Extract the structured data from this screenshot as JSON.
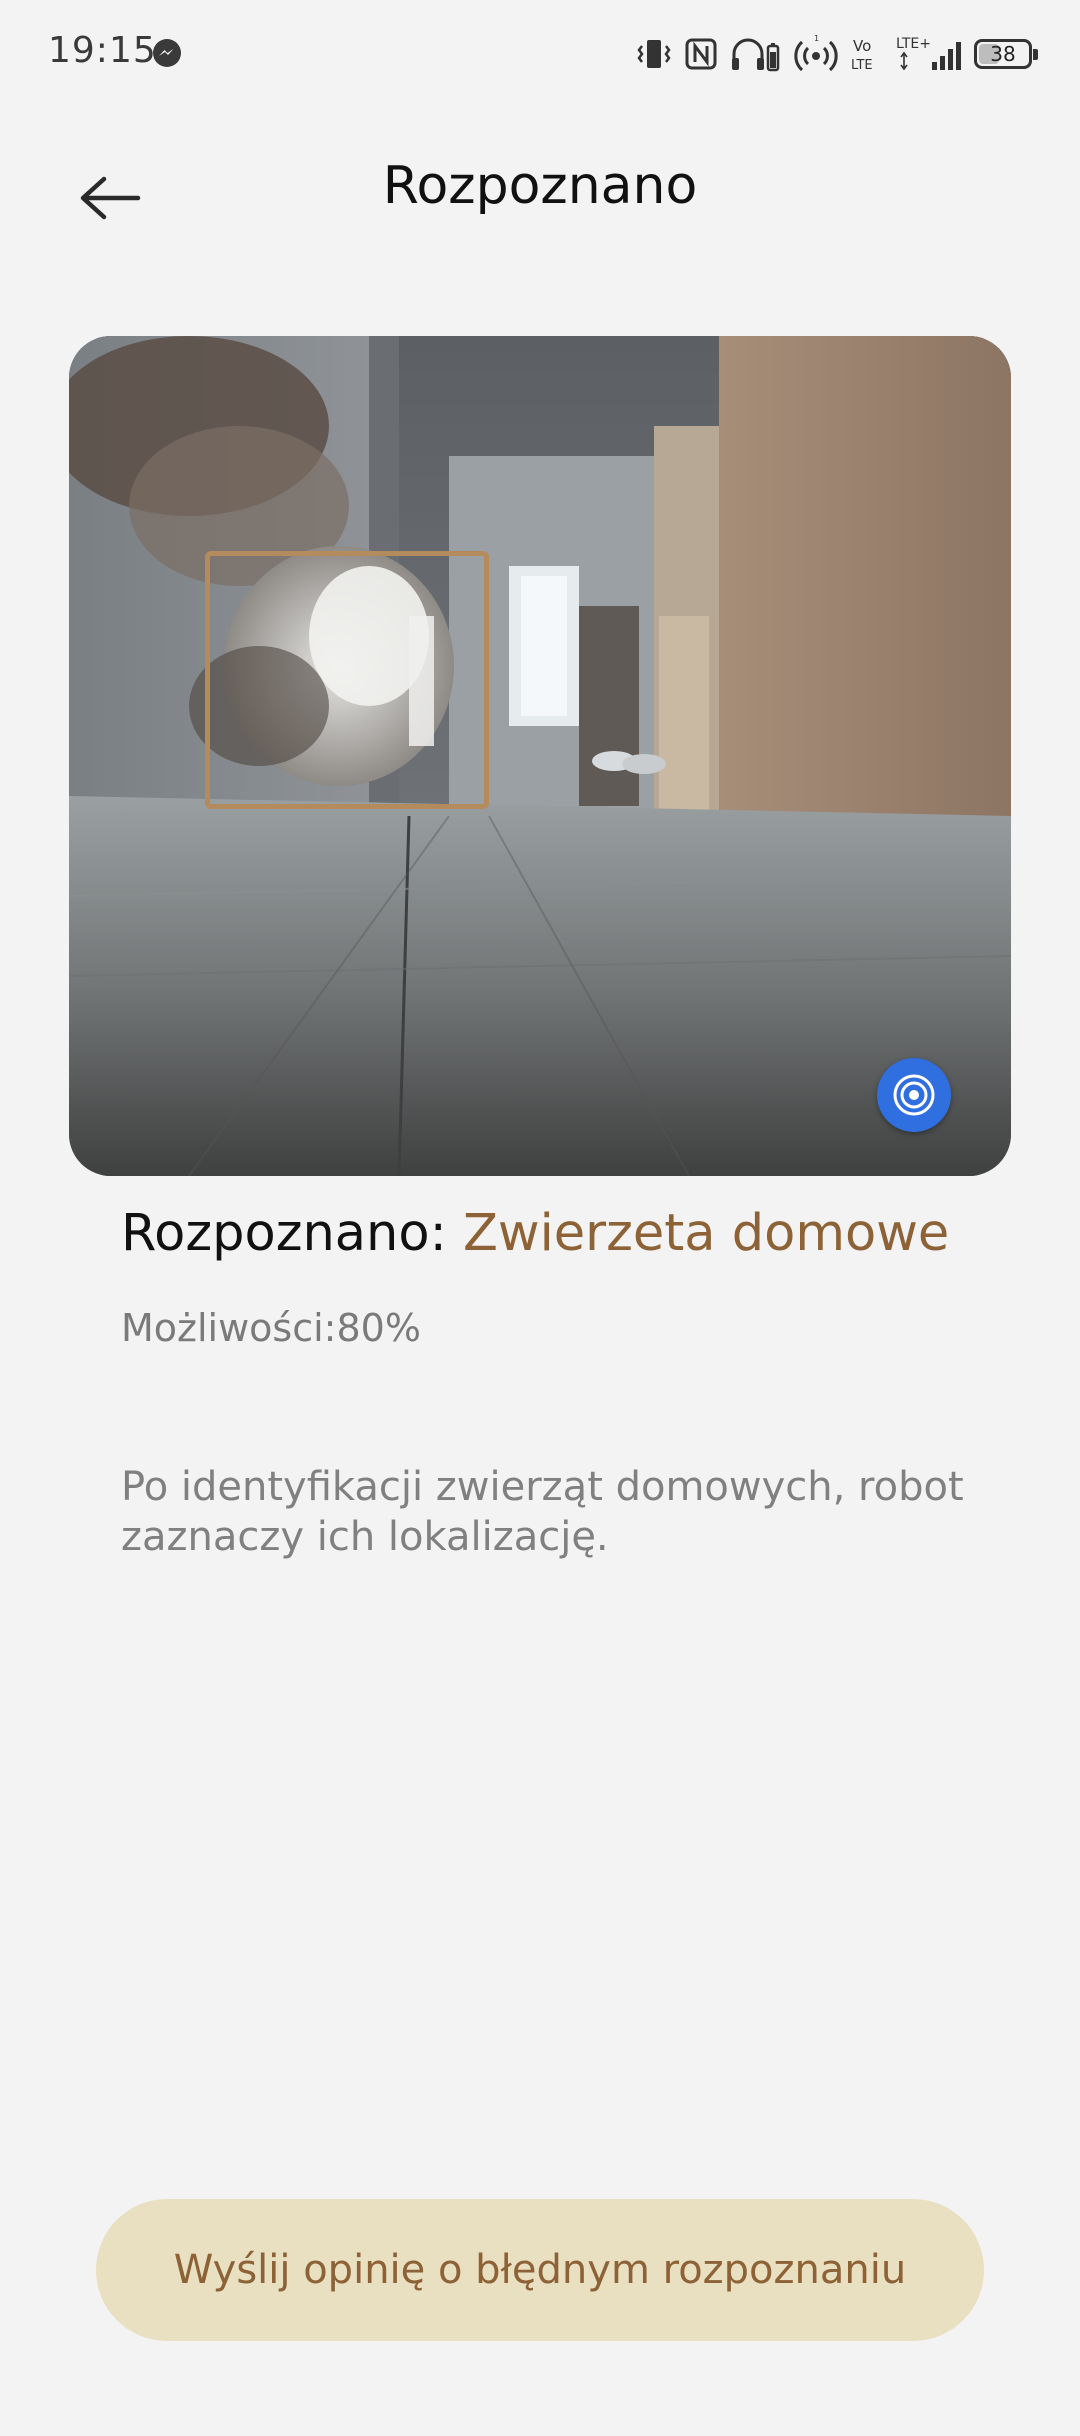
{
  "status_bar": {
    "time": "19:15",
    "battery": "38",
    "network_label_volte": "Vo LTE",
    "network_label_lte": "LTE+",
    "icons": [
      "messenger-icon",
      "vibrate-icon",
      "nfc-icon",
      "headphones-icon",
      "hotspot-icon",
      "volte-icon",
      "lte-signal-icon",
      "battery-icon"
    ]
  },
  "header": {
    "title": "Rozpoznano",
    "back_icon": "arrow-left-icon"
  },
  "photo": {
    "detection_box_color": "#b38b5c",
    "action_icon": "target-icon",
    "action_color": "#2f6fe0"
  },
  "result": {
    "label": "Rozpoznano: ",
    "value": "Zwierzeta domowe",
    "value_color": "#8d6236",
    "probability": "Możliwości:80%"
  },
  "description": "Po identyfikacji zwierząt domowych, robot zaznaczy ich lokalizację.",
  "feedback_button": {
    "label": "Wyślij opinię o błędnym rozpoznaniu",
    "background": "#e9dfc1",
    "text_color": "#8d6236"
  }
}
